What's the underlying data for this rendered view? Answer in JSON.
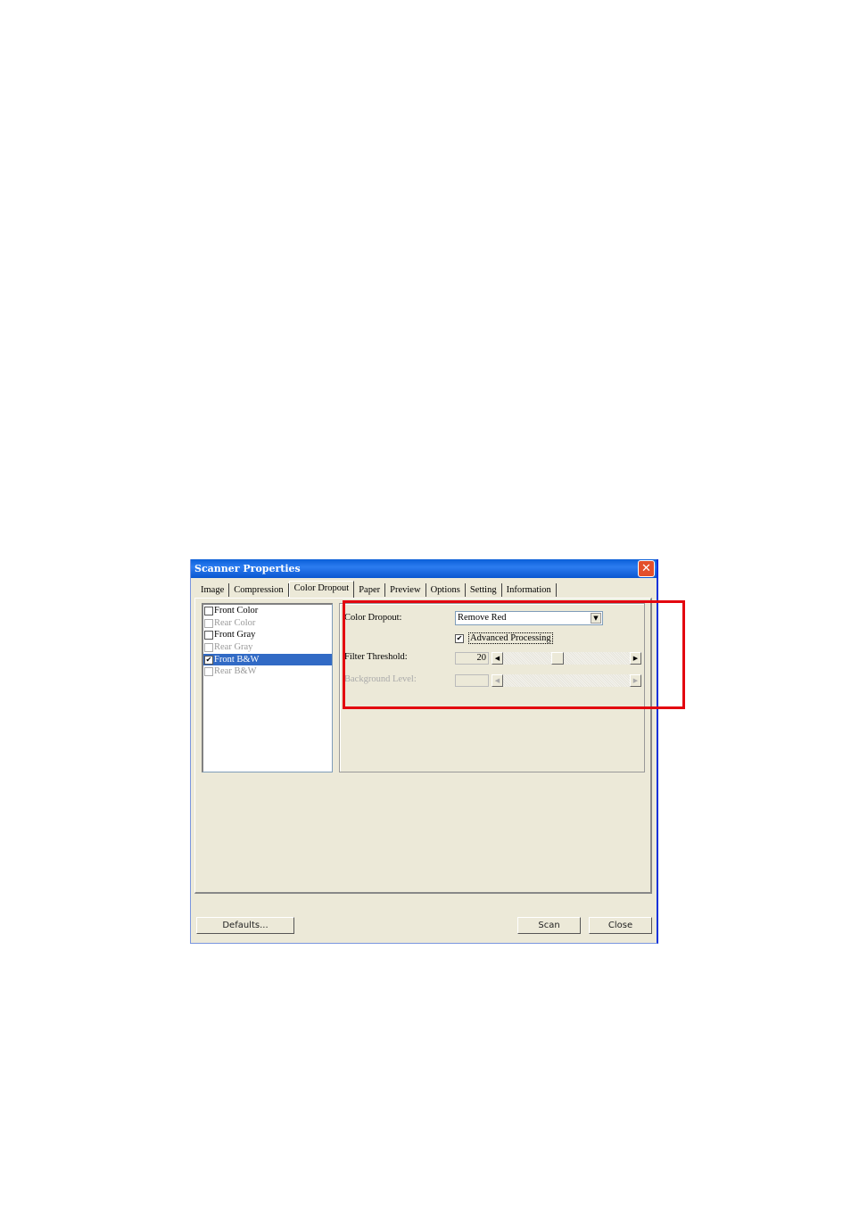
{
  "window": {
    "title": "Scanner Properties",
    "close_icon": "close-icon"
  },
  "tabs": [
    {
      "label": "Image",
      "active": false
    },
    {
      "label": "Compression",
      "active": false
    },
    {
      "label": "Color Dropout",
      "active": true
    },
    {
      "label": "Paper",
      "active": false
    },
    {
      "label": "Preview",
      "active": false
    },
    {
      "label": "Options",
      "active": false
    },
    {
      "label": "Setting",
      "active": false
    },
    {
      "label": "Information",
      "active": false
    }
  ],
  "image_list": [
    {
      "label": "Front Color",
      "checked": false,
      "enabled": true,
      "selected": false
    },
    {
      "label": "Rear Color",
      "checked": false,
      "enabled": false,
      "selected": false
    },
    {
      "label": "Front Gray",
      "checked": false,
      "enabled": true,
      "selected": false
    },
    {
      "label": "Rear Gray",
      "checked": false,
      "enabled": false,
      "selected": false
    },
    {
      "label": "Front B&W",
      "checked": true,
      "enabled": true,
      "selected": true
    },
    {
      "label": "Rear B&W",
      "checked": false,
      "enabled": false,
      "selected": false
    }
  ],
  "color_dropout": {
    "label": "Color Dropout:",
    "value": "Remove Red",
    "advanced_processing": {
      "label": "Advanced Processing",
      "checked": true
    },
    "filter_threshold": {
      "label": "Filter Threshold:",
      "value": "20",
      "slider_fraction": 0.42
    },
    "background_level": {
      "label": "Background Level:",
      "value": "",
      "enabled": false
    }
  },
  "buttons": {
    "defaults": "Defaults...",
    "scan": "Scan",
    "close": "Close"
  },
  "annotation": {
    "color": "#e3050f"
  }
}
